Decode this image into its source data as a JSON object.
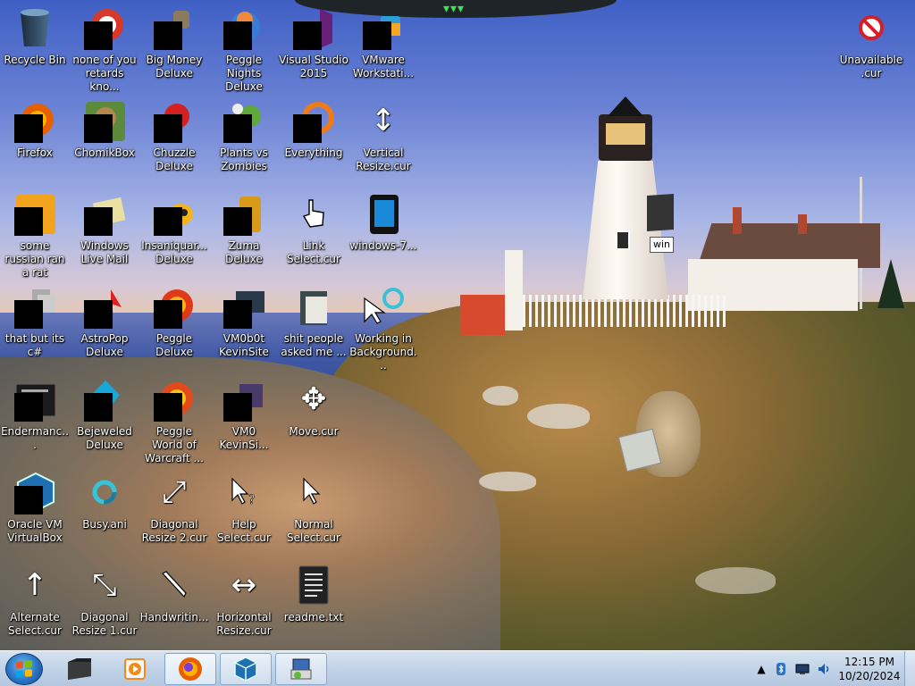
{
  "desktop": {
    "icons": [
      {
        "label": "Recycle Bin",
        "icon": "recycle-bin-icon"
      },
      {
        "label": "none of you retards kno...",
        "icon": "app-icon"
      },
      {
        "label": "Big Money Deluxe",
        "icon": "game-icon"
      },
      {
        "label": "Peggle Nights Deluxe",
        "icon": "game-icon"
      },
      {
        "label": "Visual Studio 2015",
        "icon": "visual-studio-icon"
      },
      {
        "label": "VMware Workstati...",
        "icon": "vmware-icon"
      },
      {
        "label": "Unavailable .cur",
        "icon": "unavailable-cursor-icon"
      },
      {
        "label": "Firefox",
        "icon": "firefox-icon"
      },
      {
        "label": "ChomikBox",
        "icon": "chomikbox-icon"
      },
      {
        "label": "Chuzzle Deluxe",
        "icon": "game-icon"
      },
      {
        "label": "Plants vs Zombies",
        "icon": "game-icon"
      },
      {
        "label": "Everything",
        "icon": "everything-search-icon"
      },
      {
        "label": "Vertical Resize.cur",
        "icon": "vertical-resize-cursor-icon"
      },
      {
        "label": "some russian ran a rat",
        "icon": "app-icon"
      },
      {
        "label": "Windows Live Mail",
        "icon": "mail-icon"
      },
      {
        "label": "Insaniquar... Deluxe",
        "icon": "game-icon"
      },
      {
        "label": "Zuma Deluxe",
        "icon": "game-icon"
      },
      {
        "label": "Link Select.cur",
        "icon": "hand-cursor-icon"
      },
      {
        "label": "windows-7...",
        "icon": "phone-icon"
      },
      {
        "label": "that but its c#",
        "icon": "app-icon"
      },
      {
        "label": "AstroPop Deluxe",
        "icon": "game-icon"
      },
      {
        "label": "Peggle Deluxe",
        "icon": "game-icon"
      },
      {
        "label": "VM0b0t KevinSite",
        "icon": "app-icon"
      },
      {
        "label": "shit people asked me ...",
        "icon": "folder-icon"
      },
      {
        "label": "Working in Background...",
        "icon": "working-cursor-icon"
      },
      {
        "label": "Endermanc...",
        "icon": "terminal-icon"
      },
      {
        "label": "Bejeweled Deluxe",
        "icon": "game-icon"
      },
      {
        "label": "Peggle World of Warcraft ...",
        "icon": "game-icon"
      },
      {
        "label": "VM0 KevinSi...",
        "icon": "app-icon"
      },
      {
        "label": "Move.cur",
        "icon": "move-cursor-icon"
      },
      {
        "label": "Oracle VM VirtualBox",
        "icon": "virtualbox-icon"
      },
      {
        "label": "Busy.ani",
        "icon": "busy-cursor-icon"
      },
      {
        "label": "Diagonal Resize 2.cur",
        "icon": "diagonal-resize-cursor-icon"
      },
      {
        "label": "Help Select.cur",
        "icon": "help-cursor-icon"
      },
      {
        "label": "Normal Select.cur",
        "icon": "arrow-cursor-icon"
      },
      {
        "label": "Alternate Select.cur",
        "icon": "up-arrow-cursor-icon"
      },
      {
        "label": "Diagonal Resize 1.cur",
        "icon": "diagonal-resize-cursor-icon"
      },
      {
        "label": "Handwritin...",
        "icon": "pen-cursor-icon"
      },
      {
        "label": "Horizontal Resize.cur",
        "icon": "horizontal-resize-cursor-icon"
      },
      {
        "label": "readme.txt",
        "icon": "text-file-icon"
      }
    ],
    "tooltip": "win"
  },
  "taskbar": {
    "start_icon": "windows-start-icon",
    "pinned": [
      {
        "name": "explorer",
        "icon": "folder-icon"
      },
      {
        "name": "media-player",
        "icon": "media-player-icon"
      },
      {
        "name": "firefox",
        "icon": "firefox-icon"
      },
      {
        "name": "virtualbox",
        "icon": "virtualbox-icon"
      },
      {
        "name": "installer",
        "icon": "installer-icon"
      }
    ],
    "clock": {
      "time": "12:15 PM",
      "date": "10/20/2024"
    }
  },
  "colors": {
    "taskbar": "#c2d3e7",
    "label_text": "#ffffff",
    "redaction": "#000000"
  }
}
